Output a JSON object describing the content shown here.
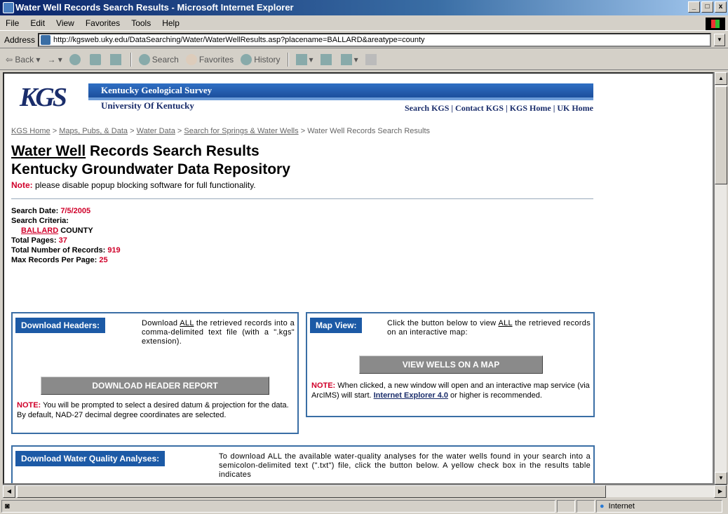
{
  "window": {
    "title": "Water Well Records Search Results - Microsoft Internet Explorer",
    "min": "_",
    "max": "□",
    "close": "x"
  },
  "menu": [
    "File",
    "Edit",
    "View",
    "Favorites",
    "Tools",
    "Help"
  ],
  "address": {
    "label": "Address",
    "url": "http://kgsweb.uky.edu/DataSearching/Water/WaterWellResults.asp?placename=BALLARD&areatype=county"
  },
  "toolbar": {
    "back": "Back",
    "forward": "→",
    "search": "Search",
    "favorites": "Favorites",
    "history": "History"
  },
  "banner": {
    "logo": "KGS",
    "org": "Kentucky Geological Survey",
    "univ": "University Of Kentucky",
    "links": "Search KGS | Contact KGS | KGS Home | UK Home"
  },
  "breadcrumb": {
    "items": [
      "KGS Home",
      "Maps, Pubs, & Data",
      "Water Data",
      "Search for Springs & Water Wells"
    ],
    "sep": ">",
    "current": "Water Well Records Search Results"
  },
  "heading": {
    "line1_u": "Water Well",
    "line1_rest": " Records Search Results",
    "line2": "Kentucky Groundwater Data Repository"
  },
  "note": {
    "label": "Note:",
    "text": " please disable popup blocking software for full functionality."
  },
  "criteria": {
    "date_label": "Search Date: ",
    "date": "7/5/2005",
    "criteria_label": "Search Criteria:",
    "county_name": "BALLARD",
    "county_suffix": " COUNTY",
    "pages_label": "Total Pages: ",
    "pages": "37",
    "records_label": "Total Number of Records: ",
    "records": "919",
    "max_label": "Max Records Per Page: ",
    "max": "25"
  },
  "download_headers": {
    "title": "Download Headers:",
    "desc_pre": "Download ",
    "desc_all": "ALL",
    "desc_post": " the retrieved records into a comma-delimited text file (with a \".kgs\" extension).",
    "button": "DOWNLOAD HEADER REPORT",
    "note_label": "NOTE:",
    "note": " You will be prompted to select a desired datum & projection for the data. By default, NAD-27 decimal degree coordinates are selected."
  },
  "map_view": {
    "title": "Map View:",
    "desc_pre": "Click the button below to view ",
    "desc_all": "ALL",
    "desc_post": " the retrieved records on an interactive map:",
    "button": "VIEW WELLS ON A MAP",
    "note_label": "NOTE:",
    "note": " When clicked, a new window will open and an interactive map service (via ArcIMS) will start. ",
    "note_link": "Internet Explorer 4.0",
    "note_end": " or higher is recommended."
  },
  "water_quality": {
    "title": "Download Water Quality Analyses:",
    "desc": "To download ALL the available water-quality analyses for the water wells found in your search into a semicolon-delimited text (\".txt\") file, click the button below. A yellow check box in the results table indicates"
  },
  "status": {
    "zone": "Internet"
  }
}
